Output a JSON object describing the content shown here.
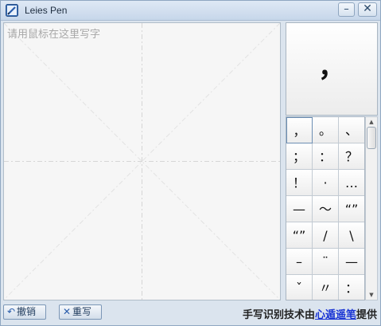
{
  "window": {
    "title": "Leies Pen",
    "minimize_glyph": "–",
    "close_glyph": "✕"
  },
  "canvas": {
    "hint": "请用鼠标在这里写字"
  },
  "preview": {
    "char": "，"
  },
  "candidates": [
    "，",
    "。",
    "、",
    "；",
    "：",
    "？",
    "！",
    "·",
    "…",
    "—",
    "～",
    "“”",
    "“”",
    "/",
    "\\",
    "–",
    "¨",
    "—",
    "ˇ",
    "〃",
    "："
  ],
  "selected_index": 0,
  "bottom": {
    "undo_label": "撤销",
    "undo_icon": "undo-arrow-icon",
    "clear_label": "重写",
    "clear_icon": "x-icon",
    "credit_prefix": "手写识别技术由",
    "credit_link": "心遁遥笔",
    "credit_suffix": "提供"
  },
  "colors": {
    "window_bg": "#dbe4ee",
    "canvas_bg": "#f6f6f6",
    "link": "#1a35d4",
    "hint": "#a8a8a8"
  }
}
